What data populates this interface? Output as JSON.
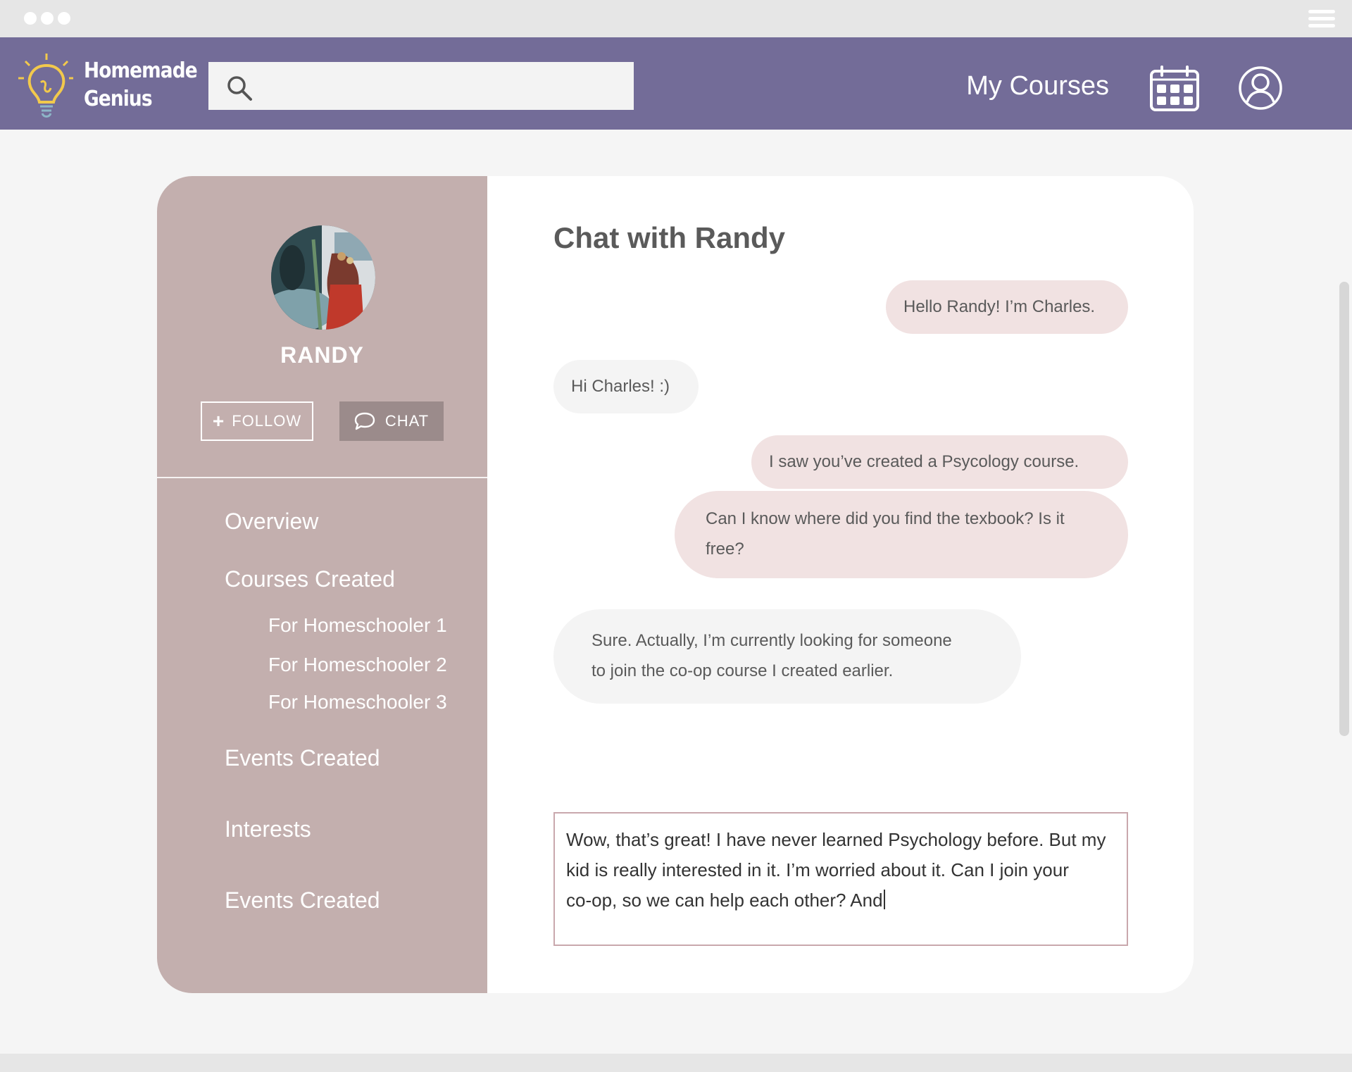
{
  "header": {
    "brand_line1": "Homemade",
    "brand_line2": "Genius",
    "search_placeholder": "",
    "my_courses_label": "My Courses",
    "icons": [
      "lightbulb-logo-icon",
      "search-icon",
      "calendar-icon",
      "user-account-icon"
    ],
    "colors": {
      "header_bg": "#736c98",
      "logo_accent": "#f2c94c"
    }
  },
  "profile": {
    "name": "RANDY",
    "follow_label": "FOLLOW",
    "chat_label": "CHAT",
    "colors": {
      "sidebar_bg": "#c3afae",
      "chat_button_bg": "#9b8b8b"
    }
  },
  "sidebar_nav": {
    "overview": "Overview",
    "courses_created": "Courses Created",
    "course_items": [
      "For Homeschooler 1",
      "For Homeschooler 2",
      "For Homeschooler 3"
    ],
    "events_created": "Events Created",
    "interests": "Interests",
    "events_created_2": "Events Created"
  },
  "chat": {
    "title": "Chat with Randy",
    "messages": [
      {
        "from": "me",
        "lines": [
          "Hello Randy! I’m Charles."
        ]
      },
      {
        "from": "randy",
        "lines": [
          "Hi Charles! :)"
        ]
      },
      {
        "from": "me",
        "lines": [
          "I saw you’ve created a Psycology course."
        ]
      },
      {
        "from": "me",
        "lines": [
          "Can I know where did you find the texbook? Is it",
          "free?"
        ]
      },
      {
        "from": "randy",
        "lines": [
          "Sure. Actually, I’m currently looking for someone",
          "to join the co-op course I created earlier."
        ]
      }
    ],
    "draft_lines": [
      "Wow, that’s great! I have never learned Psychology before. But my",
      "kid is really interested in it. I’m worried about it. Can I join your",
      "co-op, so we can help each other? And"
    ],
    "colors": {
      "outgoing_bubble": "#f1e2e2",
      "incoming_bubble": "#f4f4f4",
      "composer_border": "#c9a8ad"
    }
  }
}
